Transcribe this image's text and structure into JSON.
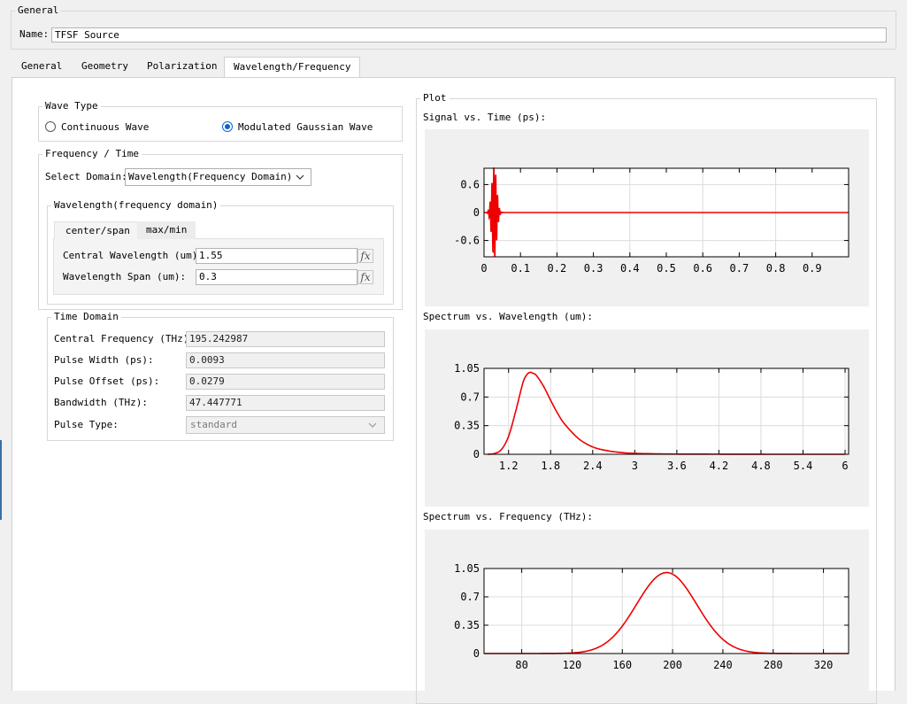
{
  "general": {
    "legend": "General",
    "name_label": "Name:",
    "name_value": "TFSF Source"
  },
  "tabs": [
    {
      "label": "General"
    },
    {
      "label": "Geometry"
    },
    {
      "label": "Polarization"
    },
    {
      "label": "Wavelength/Frequency",
      "active": true
    }
  ],
  "wave_type": {
    "legend": "Wave Type",
    "continuous_label": "Continuous Wave",
    "gaussian_label": "Modulated Gaussian Wave",
    "selected": "Modulated Gaussian Wave"
  },
  "freq_time": {
    "legend": "Frequency / Time",
    "domain_label": "Select Domain:",
    "domain_value": "Wavelength(Frequency Domain)",
    "wavelength_group": {
      "legend": "Wavelength(frequency domain)",
      "subtabs": [
        "center/span",
        "max/min"
      ],
      "active_subtab": "center/span",
      "central_label": "Central Wavelength (um):",
      "central_value": "1.55",
      "span_label": "Wavelength Span (um):",
      "span_value": "0.3",
      "fx_symbol": "fx"
    }
  },
  "time_domain": {
    "legend": "Time Domain",
    "rows": [
      {
        "label": "Central Frequency (THz):",
        "value": "195.242987"
      },
      {
        "label": "Pulse Width (ps):",
        "value": "0.0093"
      },
      {
        "label": "Pulse Offset (ps):",
        "value": "0.0279"
      },
      {
        "label": "Bandwidth (THz):",
        "value": "47.447771"
      }
    ],
    "pulse_type_label": "Pulse Type:",
    "pulse_type_value": "standard"
  },
  "plot": {
    "legend": "Plot",
    "line_color": "#ee0000",
    "titles": [
      "Signal vs. Time (ps):",
      "Spectrum vs. Wavelength (um):",
      "Spectrum vs. Frequency (THz):"
    ]
  },
  "chart_data": [
    {
      "type": "line",
      "title": "Signal vs. Time (ps):",
      "xlim": [
        0,
        1
      ],
      "ylim": [
        -0.95,
        0.95
      ],
      "x_ticks": [
        0,
        0.1,
        0.2,
        0.3,
        0.4,
        0.5,
        0.6,
        0.7,
        0.8,
        0.9
      ],
      "x_tick_labels": [
        "0",
        "0.1",
        "0.2",
        "0.3",
        "0.4",
        "0.5",
        "0.6",
        "0.7",
        "0.8",
        "0.9"
      ],
      "y_ticks": [
        0.6,
        0,
        -0.6
      ],
      "y_tick_labels": [
        "0.6",
        "0",
        "-0.6"
      ],
      "x_grid": [
        0,
        0.2,
        0.4,
        0.6,
        0.8,
        1.0
      ],
      "grid": true,
      "series": [
        {
          "kind": "modulated_gaussian",
          "center": 0.0279,
          "width": 0.0093,
          "carrier_frequency": 195.242987,
          "amplitude": 1,
          "x": [
            0,
            1
          ]
        }
      ]
    },
    {
      "type": "line",
      "title": "Spectrum vs. Wavelength (um):",
      "xlim": [
        0.85,
        6.05
      ],
      "ylim": [
        0,
        1.05
      ],
      "x_ticks": [
        1.2,
        1.8,
        2.4,
        3,
        3.6,
        4.2,
        4.8,
        5.4,
        6
      ],
      "x_tick_labels": [
        "1.2",
        "1.8",
        "2.4",
        "3",
        "3.6",
        "4.2",
        "4.8",
        "5.4",
        "6"
      ],
      "y_ticks": [
        1.05,
        0.7,
        0.35,
        0
      ],
      "y_tick_labels": [
        "1.05",
        "0.7",
        "0.35",
        "0"
      ],
      "grid": true,
      "series": [
        {
          "x": [
            0.9,
            1.0,
            1.1,
            1.2,
            1.3,
            1.4,
            1.45,
            1.5,
            1.55,
            1.6,
            1.7,
            1.8,
            1.9,
            2.0,
            2.2,
            2.4,
            2.6,
            2.8,
            3.0,
            3.4,
            3.8,
            4.4,
            5.0,
            6.0
          ],
          "y": [
            0.0,
            0.01,
            0.06,
            0.22,
            0.52,
            0.86,
            0.96,
            1.0,
            0.99,
            0.96,
            0.83,
            0.66,
            0.5,
            0.37,
            0.19,
            0.09,
            0.045,
            0.022,
            0.011,
            0.004,
            0.002,
            0.001,
            0.0,
            0.0
          ]
        }
      ]
    },
    {
      "type": "line",
      "title": "Spectrum vs. Frequency (THz):",
      "xlim": [
        50,
        340
      ],
      "ylim": [
        0,
        1.05
      ],
      "x_ticks": [
        80,
        120,
        160,
        200,
        240,
        280,
        320
      ],
      "x_tick_labels": [
        "80",
        "120",
        "160",
        "200",
        "240",
        "280",
        "320"
      ],
      "y_ticks": [
        1.05,
        0.7,
        0.35,
        0
      ],
      "y_tick_labels": [
        "1.05",
        "0.7",
        "0.35",
        "0"
      ],
      "grid": true,
      "series": [
        {
          "kind": "gaussian",
          "center": 195.242987,
          "bandwidth": 47.447771,
          "amplitude": 1,
          "x": [
            50,
            340
          ]
        }
      ]
    }
  ]
}
